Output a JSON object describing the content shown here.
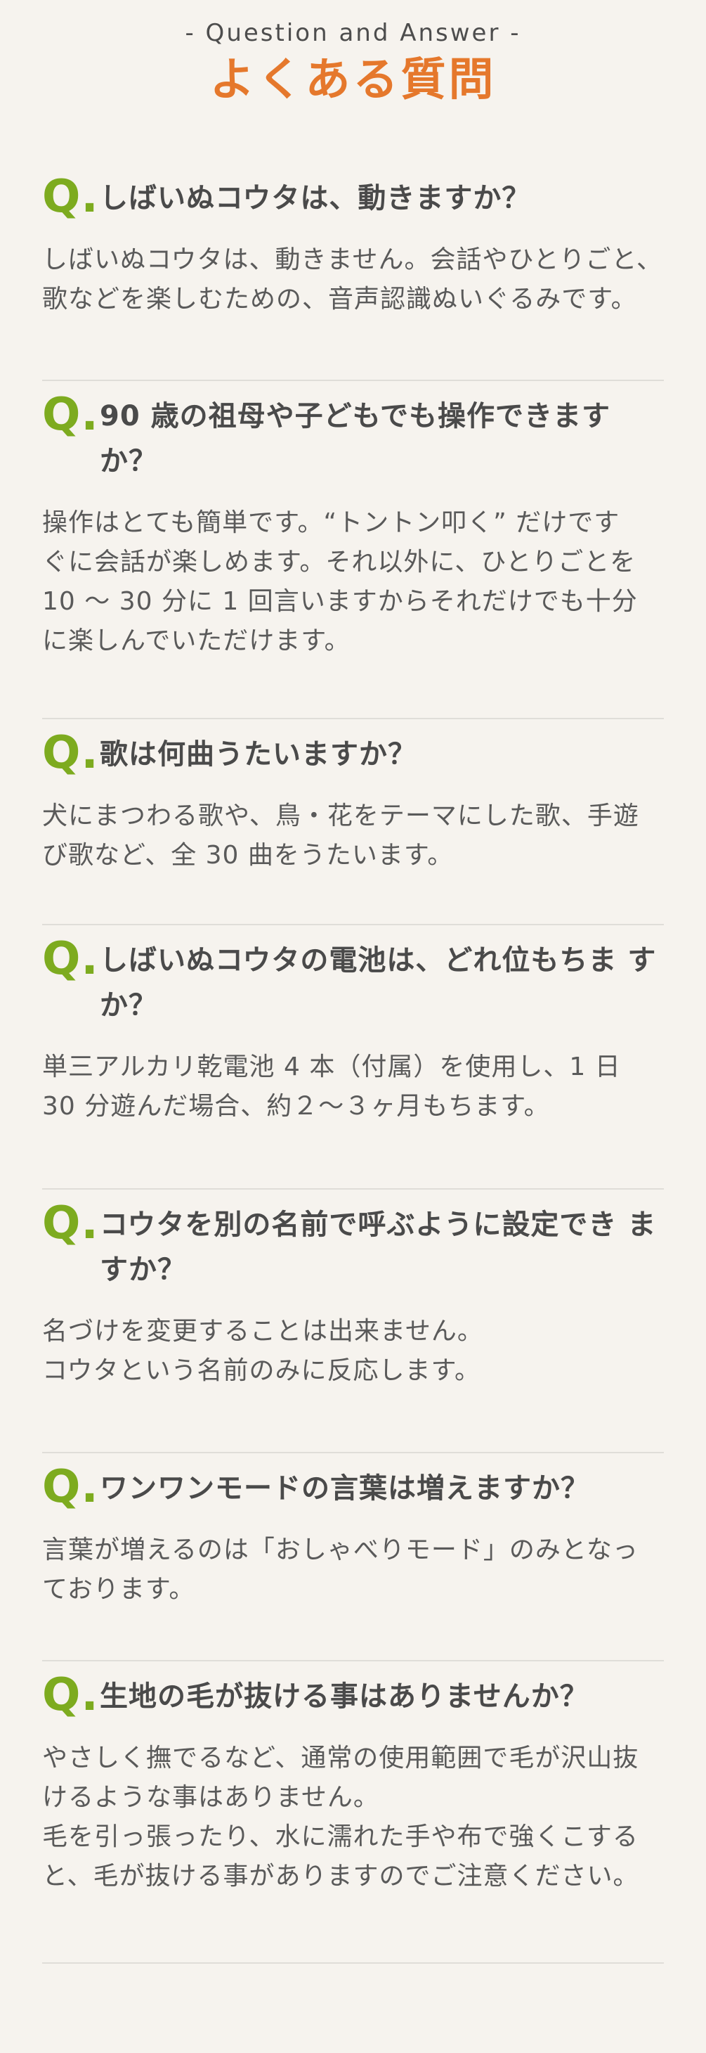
{
  "header": {
    "eyebrow": "- Question and Answer -",
    "title": "よくある質問"
  },
  "faq": {
    "items": [
      {
        "question": "しばいぬコウタは、動きますか？",
        "answer": "しばいぬコウタは、動きません。会話やひとりごと、\n歌などを楽しむための、音声認識ぬいぐるみです。"
      },
      {
        "question": "90 歳の祖母や子どもでも操作できます\nか？",
        "answer": "操作はとても簡単です。“トントン叩く” だけです\nぐに会話が楽しめます。それ以外に、ひとりごとを\n10 〜 30 分に 1 回言いますからそれだけでも十分\nに楽しんでいただけます。"
      },
      {
        "question": "歌は何曲うたいますか？",
        "answer": "犬にまつわる歌や、鳥・花をテーマにした歌、手遊\nび歌など、全 30 曲をうたいます。"
      },
      {
        "question": "しばいぬコウタの電池は、どれ位もちま\nすか？",
        "answer": "単三アルカリ乾電池 4 本（付属）を使用し、1 日\n30 分遊んだ場合、約２〜３ヶ月もちます。"
      },
      {
        "question": "コウタを別の名前で呼ぶように設定でき\nますか？",
        "answer": "名づけを変更することは出来ません。\nコウタという名前のみに反応します。"
      },
      {
        "question": "ワンワンモードの言葉は増えますか？",
        "answer": "言葉が増えるのは「おしゃべりモード」のみとなっ\nております。"
      },
      {
        "question": "生地の毛が抜ける事はありませんか？",
        "answer": "やさしく撫でるなど、通常の使用範囲で毛が沢山抜\nけるような事はありません。\n毛を引っ張ったり、水に濡れた手や布で強くこする\nと、毛が抜ける事がありますのでご注意ください。"
      }
    ],
    "q_mark": "Q."
  },
  "colors": {
    "background": "#f6f3ee",
    "accent_orange": "#e5782c",
    "accent_green": "#7dab1f",
    "text": "#4a4a4a",
    "divider": "#dfddd8"
  }
}
